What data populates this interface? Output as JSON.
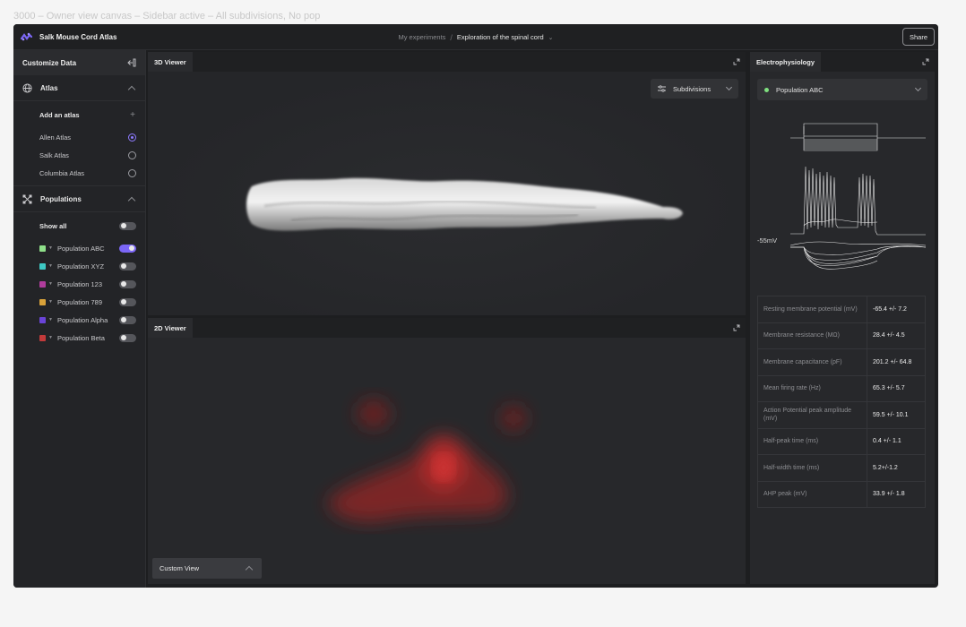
{
  "canvas": {
    "title": "3000 – Owner view canvas – Sidebar active – All subdivisions, No pop"
  },
  "header": {
    "app_title": "Salk Mouse Cord Atlas",
    "breadcrumb_parent": "My experiments",
    "breadcrumb_separator": "/",
    "breadcrumb_current": "Exploration of the spinal cord",
    "share_label": "Share"
  },
  "sidebar": {
    "title": "Customize Data",
    "atlas": {
      "label": "Atlas",
      "add_label": "Add an atlas",
      "options": [
        {
          "label": "Allen Atlas",
          "selected": true
        },
        {
          "label": "Salk Atlas",
          "selected": false
        },
        {
          "label": "Columbia Atlas",
          "selected": false
        }
      ]
    },
    "populations": {
      "label": "Populations",
      "show_all_label": "Show all",
      "show_all_on": false,
      "items": [
        {
          "label": "Population ABC",
          "color": "#8fe08a",
          "on": true
        },
        {
          "label": "Population XYZ",
          "color": "#3ec9c4",
          "on": false
        },
        {
          "label": "Population 123",
          "color": "#b03c9c",
          "on": false
        },
        {
          "label": "Population 789",
          "color": "#d9a23a",
          "on": false
        },
        {
          "label": "Population Alpha",
          "color": "#6a44d8",
          "on": false
        },
        {
          "label": "Population Beta",
          "color": "#c23a3a",
          "on": false
        }
      ]
    }
  },
  "viewer3d": {
    "tab": "3D Viewer",
    "dropdown_label": "Subdivisions"
  },
  "viewer2d": {
    "tab": "2D Viewer",
    "custom_view_label": "Custom View"
  },
  "ephys": {
    "tab": "Electrophysiology",
    "population_label": "Population ABC",
    "population_color": "#7fe07f",
    "trace_label": "-55mV",
    "rows": [
      {
        "label": "Resting membrane potential (mV)",
        "value": "-65.4 +/- 7.2"
      },
      {
        "label": "Membrane resistance (MΩ)",
        "value": "28.4 +/- 4.5"
      },
      {
        "label": "Membrane capacitance (pF)",
        "value": "201.2 +/- 64.8"
      },
      {
        "label": "Mean firing rate (Hz)",
        "value": "65.3 +/- 5.7"
      },
      {
        "label": "Action Potential peak amplitude (mV)",
        "value": "59.5 +/- 10.1"
      },
      {
        "label": "Half-peak time (ms)",
        "value": "0.4 +/- 1.1"
      },
      {
        "label": "Half-width time (ms)",
        "value": "5.2+/-1.2"
      },
      {
        "label": "AHP peak (mV)",
        "value": "33.9 +/- 1.8"
      }
    ]
  },
  "icons": {
    "logo": "salk-logo-icon",
    "collapse": "sidebar-collapse-icon",
    "atlas": "globe-icon",
    "populations": "network-icon",
    "expand": "expand-icon",
    "filter": "sliders-icon"
  }
}
